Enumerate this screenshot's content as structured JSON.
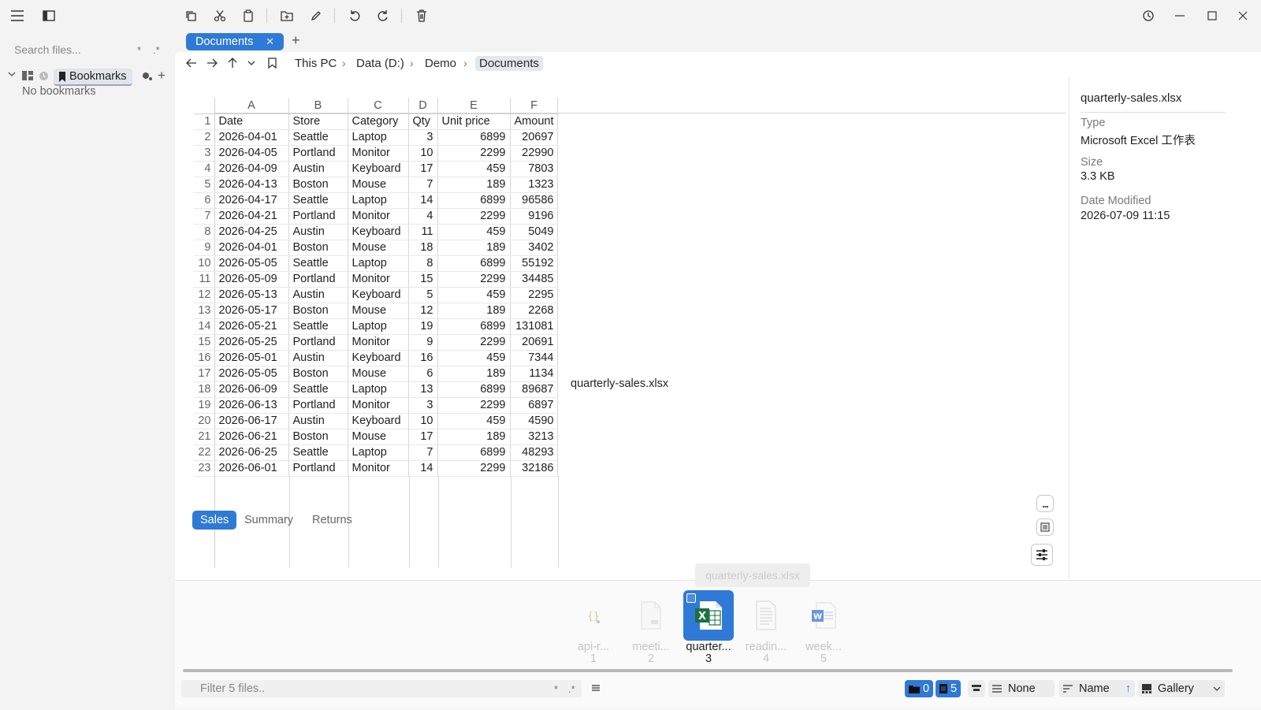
{
  "sidebar": {
    "search_placeholder": "Search files...",
    "glyph_a": "*",
    "glyph_b": ".*",
    "bookmarks_label": "Bookmarks",
    "no_bookmarks": "No bookmarks"
  },
  "tabs": [
    {
      "label": "Documents"
    }
  ],
  "breadcrumb": [
    "This PC",
    "Data (D:)",
    "Demo",
    "Documents"
  ],
  "sheet": {
    "columns": [
      "A",
      "B",
      "C",
      "D",
      "E",
      "F"
    ],
    "rows": [
      [
        "1",
        "Date",
        "Store",
        "Category",
        "Qty",
        "Unit price",
        "Amount"
      ],
      [
        "2",
        "2026-04-01",
        "Seattle",
        "Laptop",
        "3",
        "6899",
        "20697"
      ],
      [
        "3",
        "2026-04-05",
        "Portland",
        "Monitor",
        "10",
        "2299",
        "22990"
      ],
      [
        "4",
        "2026-04-09",
        "Austin",
        "Keyboard",
        "17",
        "459",
        "7803"
      ],
      [
        "5",
        "2026-04-13",
        "Boston",
        "Mouse",
        "7",
        "189",
        "1323"
      ],
      [
        "6",
        "2026-04-17",
        "Seattle",
        "Laptop",
        "14",
        "6899",
        "96586"
      ],
      [
        "7",
        "2026-04-21",
        "Portland",
        "Monitor",
        "4",
        "2299",
        "9196"
      ],
      [
        "8",
        "2026-04-25",
        "Austin",
        "Keyboard",
        "11",
        "459",
        "5049"
      ],
      [
        "9",
        "2026-04-01",
        "Boston",
        "Mouse",
        "18",
        "189",
        "3402"
      ],
      [
        "10",
        "2026-05-05",
        "Seattle",
        "Laptop",
        "8",
        "6899",
        "55192"
      ],
      [
        "11",
        "2026-05-09",
        "Portland",
        "Monitor",
        "15",
        "2299",
        "34485"
      ],
      [
        "12",
        "2026-05-13",
        "Austin",
        "Keyboard",
        "5",
        "459",
        "2295"
      ],
      [
        "13",
        "2026-05-17",
        "Boston",
        "Mouse",
        "12",
        "189",
        "2268"
      ],
      [
        "14",
        "2026-05-21",
        "Seattle",
        "Laptop",
        "19",
        "6899",
        "131081"
      ],
      [
        "15",
        "2026-05-25",
        "Portland",
        "Monitor",
        "9",
        "2299",
        "20691"
      ],
      [
        "16",
        "2026-05-01",
        "Austin",
        "Keyboard",
        "16",
        "459",
        "7344"
      ],
      [
        "17",
        "2026-05-05",
        "Boston",
        "Mouse",
        "6",
        "189",
        "1134"
      ],
      [
        "18",
        "2026-06-09",
        "Seattle",
        "Laptop",
        "13",
        "6899",
        "89687"
      ],
      [
        "19",
        "2026-06-13",
        "Portland",
        "Monitor",
        "3",
        "2299",
        "6897"
      ],
      [
        "20",
        "2026-06-17",
        "Austin",
        "Keyboard",
        "10",
        "459",
        "4590"
      ],
      [
        "21",
        "2026-06-21",
        "Boston",
        "Mouse",
        "17",
        "189",
        "3213"
      ],
      [
        "22",
        "2026-06-25",
        "Seattle",
        "Laptop",
        "7",
        "6899",
        "48293"
      ],
      [
        "23",
        "2026-06-01",
        "Portland",
        "Monitor",
        "14",
        "2299",
        "32186"
      ]
    ],
    "sheet_tabs": [
      "Sales",
      "Summary",
      "Returns"
    ],
    "active_tab": "Sales",
    "overlay_label": "quarterly-sales.xlsx",
    "more_button_label": "..."
  },
  "details": {
    "filename": "quarterly-sales.xlsx",
    "type_label": "Type",
    "type_value": "Microsoft Excel 工作表",
    "size_label": "Size",
    "size_value": "3.3 KB",
    "modified_label": "Date Modified",
    "modified_value": "2026-07-09 11:15"
  },
  "gallery": {
    "tooltip": "quarterly-sales.xlsx",
    "items": [
      {
        "name": "api-r...",
        "index": "1",
        "icon": "json-file-icon"
      },
      {
        "name": "meeti...",
        "index": "2",
        "icon": "document-file-icon"
      },
      {
        "name": "quarter...",
        "index": "3",
        "icon": "excel-file-icon"
      },
      {
        "name": "readin...",
        "index": "4",
        "icon": "text-file-icon"
      },
      {
        "name": "week...",
        "index": "5",
        "icon": "word-file-icon"
      }
    ],
    "selected_index": 3
  },
  "statusbar": {
    "filter_placeholder": "Filter 5 files..",
    "glyph_a": "*",
    "glyph_b": ".*",
    "folder_count": "0",
    "file_count": "5",
    "group_value": "None",
    "sort_value": "Name",
    "view_value": "Gallery"
  },
  "colors": {
    "accent": "#2f7ad6",
    "excel_green": "#1d7044",
    "word_blue": "#2b5fb4"
  }
}
